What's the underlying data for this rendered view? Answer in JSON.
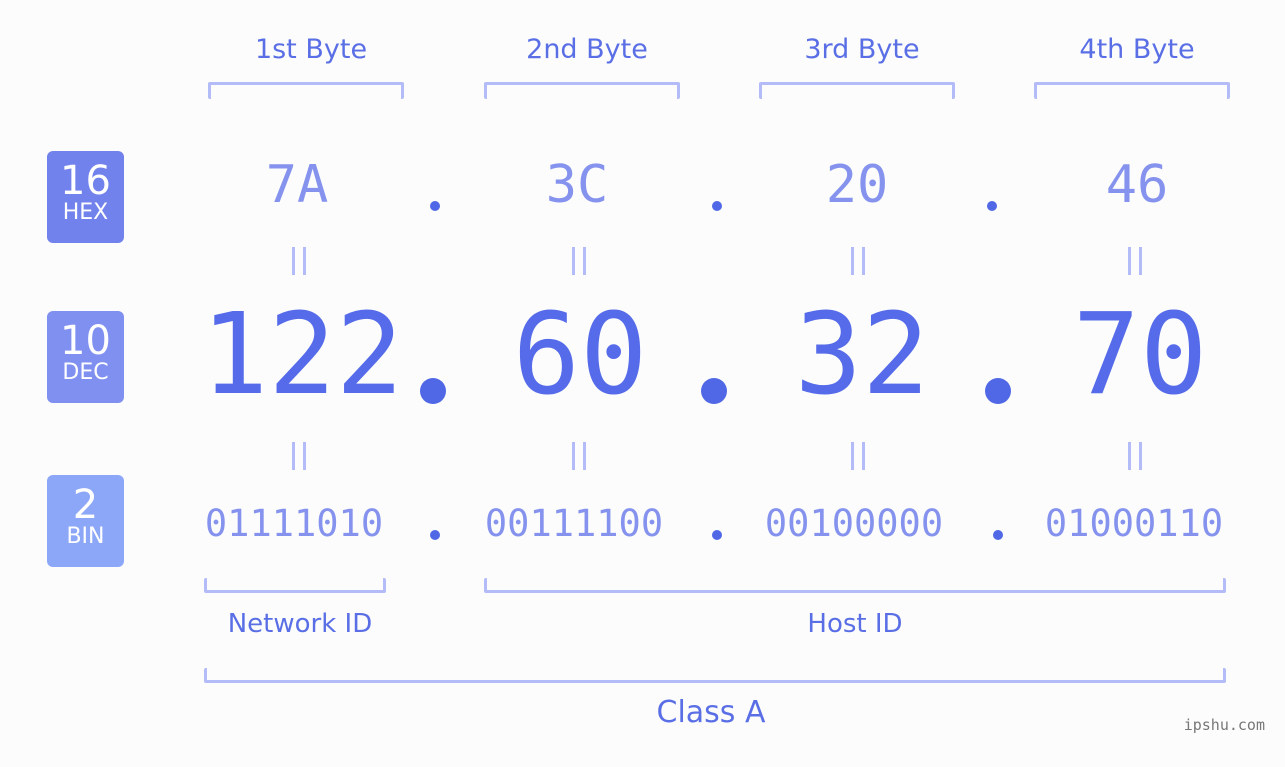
{
  "bytes": [
    {
      "label": "1st Byte",
      "hex": "7A",
      "dec": "122",
      "bin": "01111010"
    },
    {
      "label": "2nd Byte",
      "hex": "3C",
      "dec": "60",
      "bin": "00111100"
    },
    {
      "label": "3rd Byte",
      "hex": "20",
      "dec": "32",
      "bin": "00100000"
    },
    {
      "label": "4th Byte",
      "hex": "46",
      "dec": "70",
      "bin": "01000110"
    }
  ],
  "badges": {
    "hex": {
      "num": "16",
      "label": "HEX",
      "color": "#7282ec"
    },
    "dec": {
      "num": "10",
      "label": "DEC",
      "color": "#8090f0"
    },
    "bin": {
      "num": "2",
      "label": "BIN",
      "color": "#8da7f8"
    }
  },
  "segments": {
    "network": "Network ID",
    "host": "Host ID",
    "class": "Class A"
  },
  "watermark": "ipshu.com",
  "colors": {
    "accent": "#566bea",
    "light": "#8593ee",
    "bracket": "#b3bcf8"
  }
}
